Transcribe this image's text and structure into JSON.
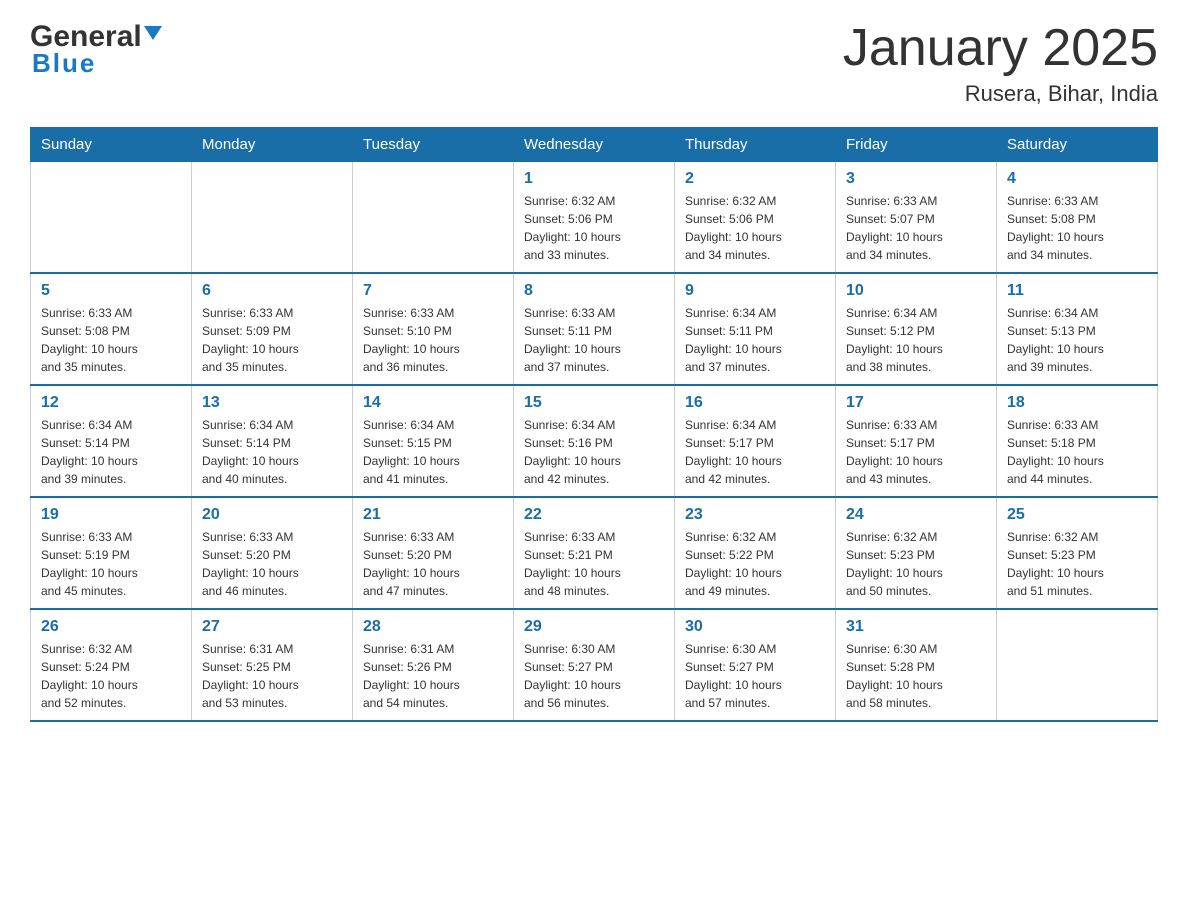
{
  "logo": {
    "general": "General",
    "blue": "Blue"
  },
  "title": "January 2025",
  "subtitle": "Rusera, Bihar, India",
  "days_of_week": [
    "Sunday",
    "Monday",
    "Tuesday",
    "Wednesday",
    "Thursday",
    "Friday",
    "Saturday"
  ],
  "weeks": [
    [
      {
        "day": "",
        "info": ""
      },
      {
        "day": "",
        "info": ""
      },
      {
        "day": "",
        "info": ""
      },
      {
        "day": "1",
        "info": "Sunrise: 6:32 AM\nSunset: 5:06 PM\nDaylight: 10 hours\nand 33 minutes."
      },
      {
        "day": "2",
        "info": "Sunrise: 6:32 AM\nSunset: 5:06 PM\nDaylight: 10 hours\nand 34 minutes."
      },
      {
        "day": "3",
        "info": "Sunrise: 6:33 AM\nSunset: 5:07 PM\nDaylight: 10 hours\nand 34 minutes."
      },
      {
        "day": "4",
        "info": "Sunrise: 6:33 AM\nSunset: 5:08 PM\nDaylight: 10 hours\nand 34 minutes."
      }
    ],
    [
      {
        "day": "5",
        "info": "Sunrise: 6:33 AM\nSunset: 5:08 PM\nDaylight: 10 hours\nand 35 minutes."
      },
      {
        "day": "6",
        "info": "Sunrise: 6:33 AM\nSunset: 5:09 PM\nDaylight: 10 hours\nand 35 minutes."
      },
      {
        "day": "7",
        "info": "Sunrise: 6:33 AM\nSunset: 5:10 PM\nDaylight: 10 hours\nand 36 minutes."
      },
      {
        "day": "8",
        "info": "Sunrise: 6:33 AM\nSunset: 5:11 PM\nDaylight: 10 hours\nand 37 minutes."
      },
      {
        "day": "9",
        "info": "Sunrise: 6:34 AM\nSunset: 5:11 PM\nDaylight: 10 hours\nand 37 minutes."
      },
      {
        "day": "10",
        "info": "Sunrise: 6:34 AM\nSunset: 5:12 PM\nDaylight: 10 hours\nand 38 minutes."
      },
      {
        "day": "11",
        "info": "Sunrise: 6:34 AM\nSunset: 5:13 PM\nDaylight: 10 hours\nand 39 minutes."
      }
    ],
    [
      {
        "day": "12",
        "info": "Sunrise: 6:34 AM\nSunset: 5:14 PM\nDaylight: 10 hours\nand 39 minutes."
      },
      {
        "day": "13",
        "info": "Sunrise: 6:34 AM\nSunset: 5:14 PM\nDaylight: 10 hours\nand 40 minutes."
      },
      {
        "day": "14",
        "info": "Sunrise: 6:34 AM\nSunset: 5:15 PM\nDaylight: 10 hours\nand 41 minutes."
      },
      {
        "day": "15",
        "info": "Sunrise: 6:34 AM\nSunset: 5:16 PM\nDaylight: 10 hours\nand 42 minutes."
      },
      {
        "day": "16",
        "info": "Sunrise: 6:34 AM\nSunset: 5:17 PM\nDaylight: 10 hours\nand 42 minutes."
      },
      {
        "day": "17",
        "info": "Sunrise: 6:33 AM\nSunset: 5:17 PM\nDaylight: 10 hours\nand 43 minutes."
      },
      {
        "day": "18",
        "info": "Sunrise: 6:33 AM\nSunset: 5:18 PM\nDaylight: 10 hours\nand 44 minutes."
      }
    ],
    [
      {
        "day": "19",
        "info": "Sunrise: 6:33 AM\nSunset: 5:19 PM\nDaylight: 10 hours\nand 45 minutes."
      },
      {
        "day": "20",
        "info": "Sunrise: 6:33 AM\nSunset: 5:20 PM\nDaylight: 10 hours\nand 46 minutes."
      },
      {
        "day": "21",
        "info": "Sunrise: 6:33 AM\nSunset: 5:20 PM\nDaylight: 10 hours\nand 47 minutes."
      },
      {
        "day": "22",
        "info": "Sunrise: 6:33 AM\nSunset: 5:21 PM\nDaylight: 10 hours\nand 48 minutes."
      },
      {
        "day": "23",
        "info": "Sunrise: 6:32 AM\nSunset: 5:22 PM\nDaylight: 10 hours\nand 49 minutes."
      },
      {
        "day": "24",
        "info": "Sunrise: 6:32 AM\nSunset: 5:23 PM\nDaylight: 10 hours\nand 50 minutes."
      },
      {
        "day": "25",
        "info": "Sunrise: 6:32 AM\nSunset: 5:23 PM\nDaylight: 10 hours\nand 51 minutes."
      }
    ],
    [
      {
        "day": "26",
        "info": "Sunrise: 6:32 AM\nSunset: 5:24 PM\nDaylight: 10 hours\nand 52 minutes."
      },
      {
        "day": "27",
        "info": "Sunrise: 6:31 AM\nSunset: 5:25 PM\nDaylight: 10 hours\nand 53 minutes."
      },
      {
        "day": "28",
        "info": "Sunrise: 6:31 AM\nSunset: 5:26 PM\nDaylight: 10 hours\nand 54 minutes."
      },
      {
        "day": "29",
        "info": "Sunrise: 6:30 AM\nSunset: 5:27 PM\nDaylight: 10 hours\nand 56 minutes."
      },
      {
        "day": "30",
        "info": "Sunrise: 6:30 AM\nSunset: 5:27 PM\nDaylight: 10 hours\nand 57 minutes."
      },
      {
        "day": "31",
        "info": "Sunrise: 6:30 AM\nSunset: 5:28 PM\nDaylight: 10 hours\nand 58 minutes."
      },
      {
        "day": "",
        "info": ""
      }
    ]
  ]
}
